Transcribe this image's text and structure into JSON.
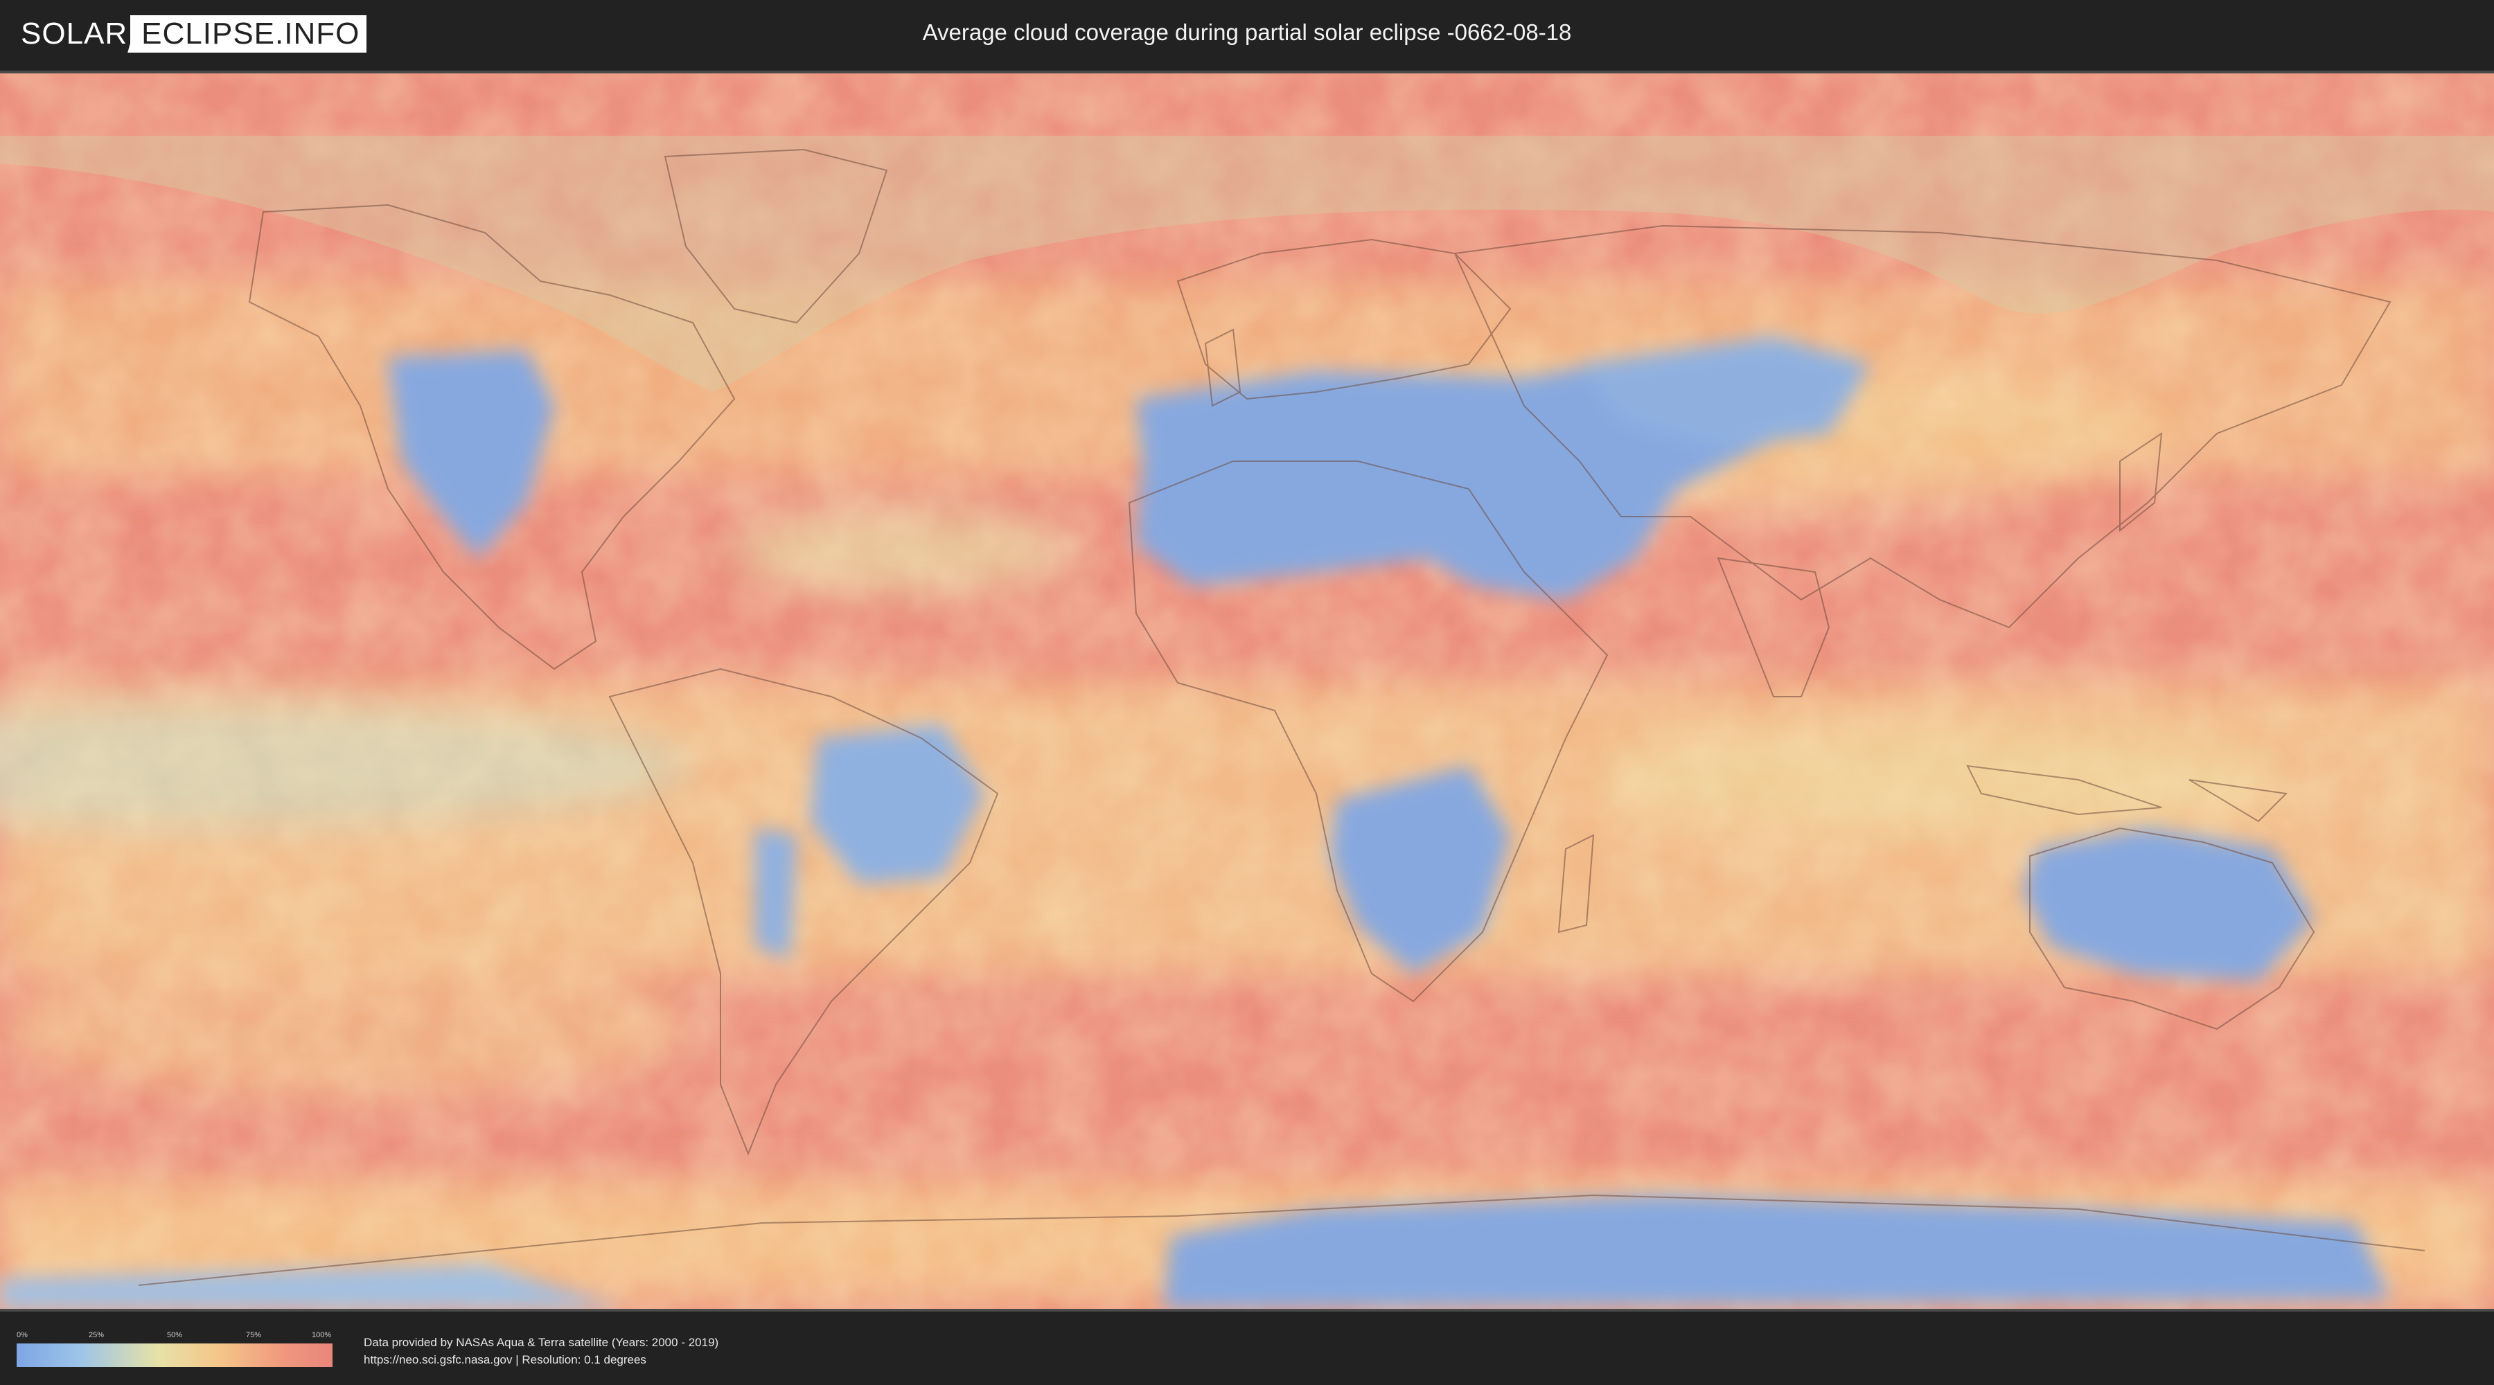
{
  "header": {
    "logo_left": "SOLAR",
    "logo_right": "ECLIPSE.INFO",
    "title": "Average cloud coverage during partial solar eclipse -0662-08-18"
  },
  "legend": {
    "ticks": [
      "0%",
      "25%",
      "50%",
      "75%",
      "100%"
    ],
    "colors": {
      "low": "#7ea6e6",
      "mid": "#e7e2a6",
      "high": "#e9867b"
    }
  },
  "footer": {
    "credit_line1": "Data provided by NASAs Aqua & Terra satellite (Years: 2000 - 2019)",
    "credit_line2": "https://neo.sci.gsfc.nasa.gov | Resolution: 0.1 degrees"
  }
}
